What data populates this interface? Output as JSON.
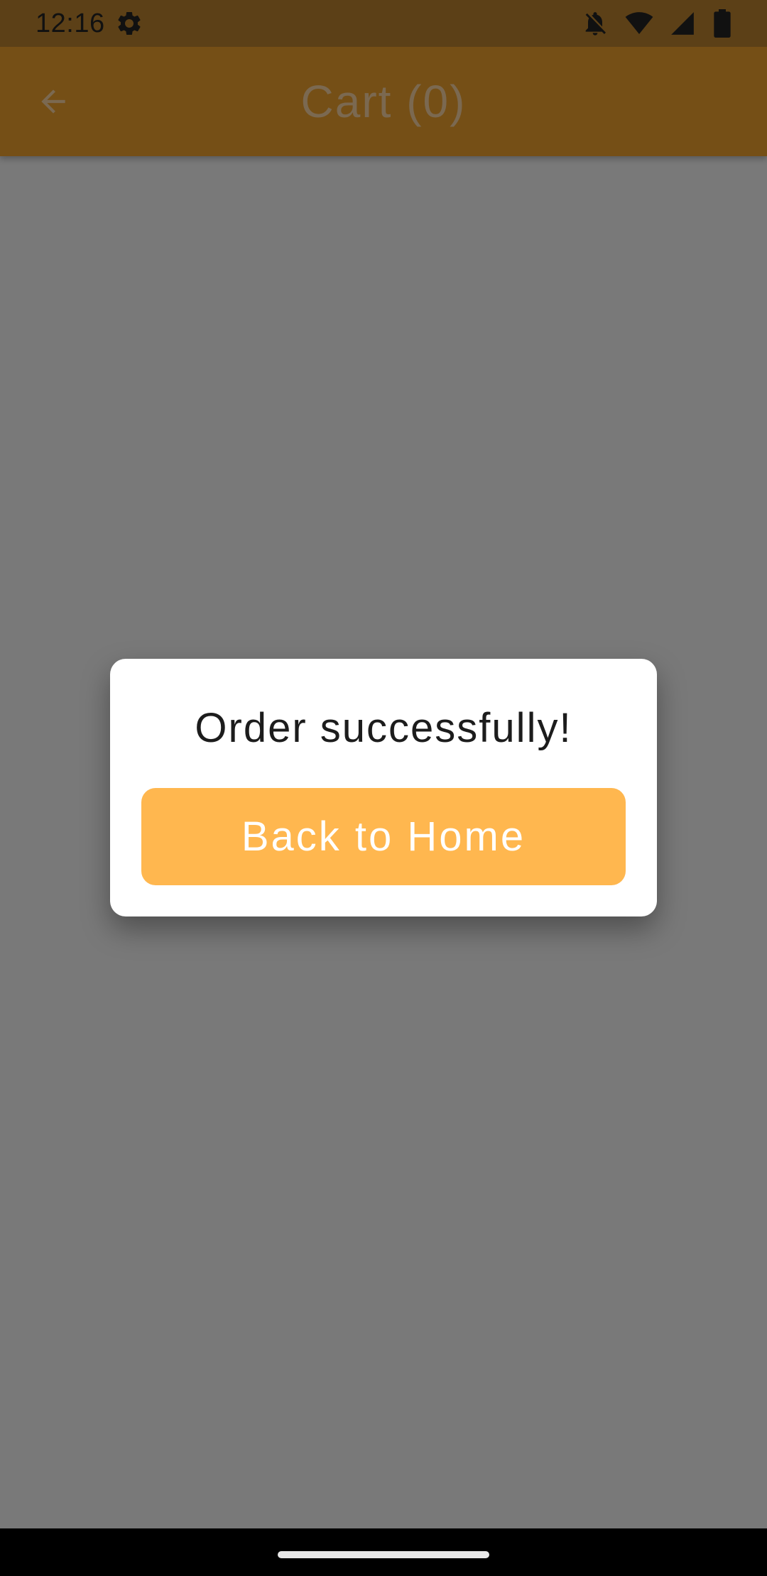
{
  "status_bar": {
    "time": "12:16",
    "icons": [
      "settings-gear-icon",
      "notifications-off-icon",
      "wifi-icon",
      "cellular-signal-icon",
      "battery-icon"
    ]
  },
  "app_bar": {
    "title": "Cart (0)",
    "back_icon": "arrow-back-icon"
  },
  "dialog": {
    "message": "Order successfully!",
    "button_label": "Back to Home"
  },
  "colors": {
    "app_bar": "#ea9f2c",
    "button": "#ffb74f",
    "dialog_bg": "#ffffff",
    "scrim": "rgba(0,0,0,0.5)"
  }
}
